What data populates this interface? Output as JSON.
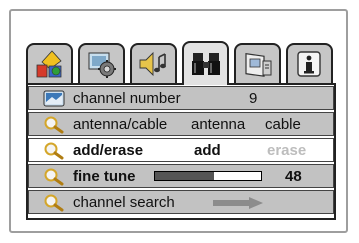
{
  "tabs": [
    {
      "name": "shapes",
      "icon": "shapes-icon"
    },
    {
      "name": "settings",
      "icon": "gear-tv-icon"
    },
    {
      "name": "audio",
      "icon": "speaker-music-icon"
    },
    {
      "name": "channels",
      "icon": "binoculars-icon",
      "active": true
    },
    {
      "name": "display",
      "icon": "screen-icon"
    },
    {
      "name": "info",
      "icon": "info-icon"
    }
  ],
  "menu": {
    "channel_number": {
      "label": "channel number",
      "value": "9",
      "icon": "tv-screen-icon"
    },
    "antenna_cable": {
      "label": "antenna/cable",
      "option1": "antenna",
      "option2": "cable",
      "icon": "magnifier-icon"
    },
    "add_erase": {
      "label": "add/erase",
      "option1": "add",
      "option2": "erase",
      "icon": "magnifier-icon",
      "selected": true
    },
    "fine_tune": {
      "label": "fine tune",
      "value": "48",
      "level_fraction": 0.56,
      "icon": "magnifier-icon"
    },
    "channel_search": {
      "label": "channel search",
      "icon": "magnifier-icon",
      "arrow": "right-arrow-icon"
    }
  },
  "colors": {
    "row_bg": "#c2c2c2",
    "selected_bg": "#ffffff",
    "tab_bg": "#c6c6c6",
    "active_tab_bg": "#e2e2e2",
    "dimmed_text": "#bdbdbd"
  }
}
